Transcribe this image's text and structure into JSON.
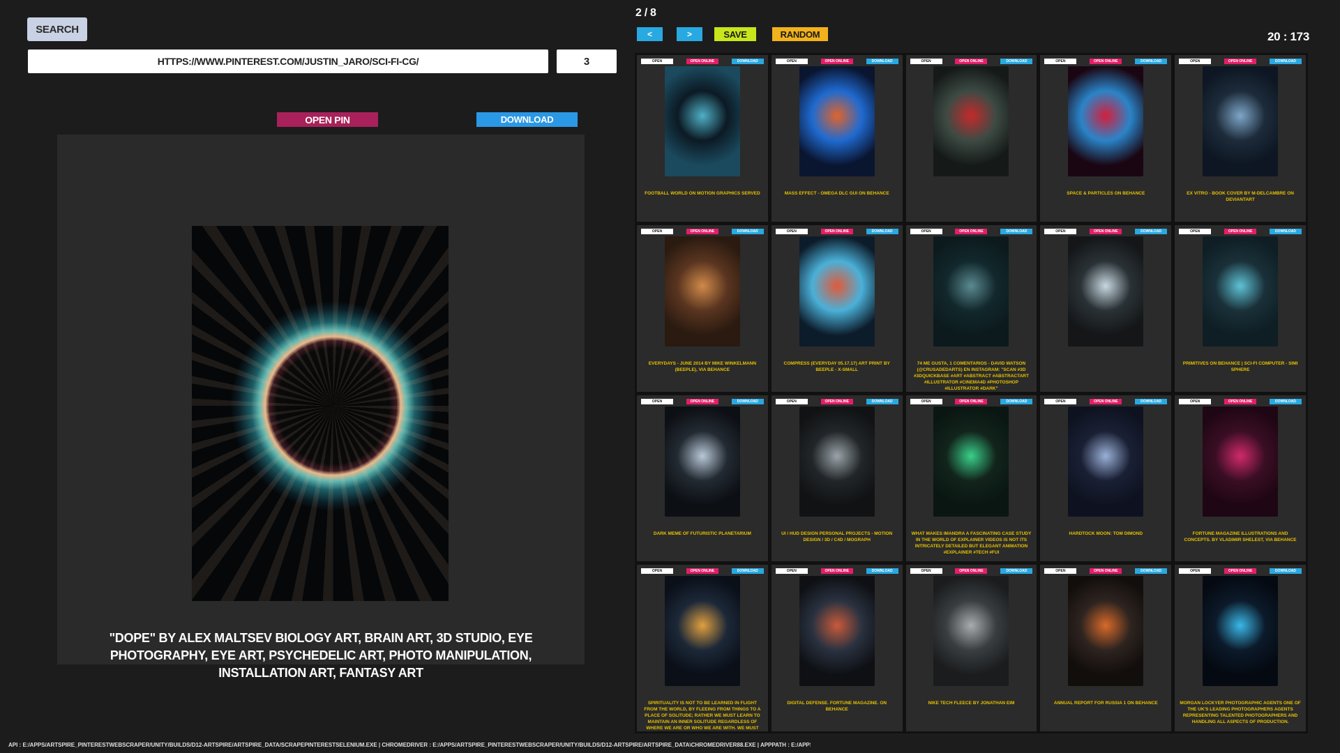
{
  "search": {
    "label": "SEARCH",
    "url_value": "HTTPS://WWW.PINTEREST.COM/JUSTIN_JARO/SCI-FI-CG/",
    "count_value": "3"
  },
  "preview": {
    "open_pin_label": "OPEN PIN",
    "download_label": "DOWNLOAD",
    "caption": "\"DOPE\" BY ALEX MALTSEV BIOLOGY ART, BRAIN ART, 3D STUDIO, EYE PHOTOGRAPHY, EYE ART, PSYCHEDELIC ART, PHOTO MANIPULATION, INSTALLATION ART, FANTASY ART"
  },
  "header": {
    "page": "2 / 8",
    "prev": "<",
    "next": ">",
    "save": "SAVE",
    "random": "RANDOM",
    "timer": "20 : 173"
  },
  "card_buttons": {
    "open": "OPEN",
    "open_online": "OPEN ONLINE",
    "download": "DOWNLOAD"
  },
  "cards": [
    {
      "caption": "FOOTBALL WORLD ON MOTION GRAPHICS SERVED",
      "colors": [
        "#1b4a5e",
        "#4fb0c6",
        "#0c1a24"
      ]
    },
    {
      "caption": "MASS EFFECT - OMEGA DLC GUI ON BEHANCE",
      "colors": [
        "#0a1530",
        "#e0642a",
        "#1f6ad0"
      ]
    },
    {
      "caption": "",
      "colors": [
        "#151a18",
        "#c42a2a",
        "#3d4a44"
      ]
    },
    {
      "caption": "SPACE & PARTICLES ON BEHANCE",
      "colors": [
        "#1a0612",
        "#d21f3c",
        "#2a84c8"
      ]
    },
    {
      "caption": "EX VITRO - BOOK COVER BY M-DELCAMBRE ON DEVIANTART",
      "colors": [
        "#0d1622",
        "#7ea6c8",
        "#1d2b3a"
      ]
    },
    {
      "caption": "EVERYDAYS - JUNE 2014 BY MIKE WINKELMANN (BEEPLE), VIA BEHANCE",
      "colors": [
        "#2a1a10",
        "#d08a4a",
        "#5a3520"
      ]
    },
    {
      "caption": "COMPRESS (EVERYDAY 05.17.17) ART PRINT BY BEEPLE - X-SMALL",
      "colors": [
        "#0d1c2a",
        "#e05a3a",
        "#4ab0d8"
      ]
    },
    {
      "caption": "74 ME GUSTA, 1 COMENTARIOS - DAVID WATSON (@CRUSADEDARTS) EN INSTAGRAM: \"SCAN #3D #3DQUICKBASE #ART #ABSTRACT #ABSTRACTART #ILLUSTRATOR #CINEMA4D #PHOTOSHOP #ILLUSTRATOR #DARK\"",
      "colors": [
        "#0c1a1d",
        "#5a8a90",
        "#12282c"
      ]
    },
    {
      "caption": "",
      "colors": [
        "#141618",
        "#c8d8e0",
        "#2a3236"
      ]
    },
    {
      "caption": "PRIMITIVES ON BEHANCE | SCI-FI COMPUTER - SIMI SPHERE",
      "colors": [
        "#0e1e24",
        "#5ec2d6",
        "#1a3038"
      ]
    },
    {
      "caption": "DARK MEME OF FUTURISTIC PLANETARIUM",
      "colors": [
        "#0c0f14",
        "#b8c8d8",
        "#232a32"
      ]
    },
    {
      "caption": "UI / HUD DESIGN PERSONAL PROJECTS - MOTION DESIGN / 3D / C4D / MOGRAPH",
      "colors": [
        "#101214",
        "#9aa4aa",
        "#222628"
      ]
    },
    {
      "caption": "WHAT MAKES IMANDRA A FASCINATING CASE STUDY IN THE WORLD OF EXPLAINER VIDEOS IS NOT ITS INTRICATELY DETAILED BUT ELEGANT ANIMATION #EXPLAINER #TECH #FUI",
      "colors": [
        "#0a1612",
        "#3ad08a",
        "#12241c"
      ]
    },
    {
      "caption": "HARDTOCK MOON: TOM DIMOND",
      "colors": [
        "#0e1220",
        "#9ab0d8",
        "#1a2034"
      ]
    },
    {
      "caption": "FORTUNE MAGAZINE ILLUSTRATIONS AND CONCEPTS. BY VLADIMIR SHELEST, VIA BEHANCE",
      "colors": [
        "#1e0614",
        "#d02a6a",
        "#3a0e24"
      ]
    },
    {
      "caption": "SPIRITUALITY IS NOT TO BE LEARNED IN FLIGHT FROM THE WORLD, BY FLEEING FROM THINGS TO A PLACE OF SOLITUDE; RATHER WE MUST LEARN TO MAINTAIN AN INNER SOLITUDE REGARDLESS OF WHERE WE ARE OR WHO WE ARE WITH. WE MUST LEARN TO PENETRATE THINGS, AND FIND GOD THERE. MEISTER ECKHART | FROM: ON DETACHMENT AND POSSESSING GOD",
      "colors": [
        "#0a0f18",
        "#e0a040",
        "#1c2838"
      ]
    },
    {
      "caption": "DIGITAL DEFENSE. FORTUNE MAGAZINE. ON BEHANCE",
      "colors": [
        "#0e1014",
        "#c85a3a",
        "#2a3240"
      ]
    },
    {
      "caption": "NIKE TECH FLEECE BY JONATHAN EIM",
      "colors": [
        "#1a1c1e",
        "#a8acae",
        "#3a3e40"
      ]
    },
    {
      "caption": "ANNUAL REPORT FOR RUSSIA 1 ON BEHANCE",
      "colors": [
        "#120e0c",
        "#d86a2a",
        "#2e2420"
      ]
    },
    {
      "caption": "MORGAN LOCKYER PHOTOGRAPHIC AGENTS ONE OF THE UK'S LEADING PHOTOGRAPHERS AGENTS REPRESENTING TALENTED PHOTOGRAPHERS AND HANDLING ALL ASPECTS OF PRODUCTION.",
      "colors": [
        "#050a12",
        "#3ab8e8",
        "#0c1a2a"
      ]
    }
  ],
  "status": "API : E:/APPS/ARTSPIRE_PINTERESTWEBSCRAPER/UNITY/BUILDS/D12-ARTSPIRE/ARTSPIRE_DATA/SCRAPEPINTERESTSELENIUM.EXE | CHROMEDRIVER : E:/APPS/ARTSPIRE_PINTERESTWEBSCRAPER/UNITY/BUILDS/D12-ARTSPIRE/ARTSPIRE_DATA\\CHROMEDRIVER88.EXE | APPPATH : E:/APPS/ARTSPIRE_PINTERESTWEBSCRAPER/UNITY/BUILDS/D12-ARTSPIRE/ARTSPIRE_DATA"
}
